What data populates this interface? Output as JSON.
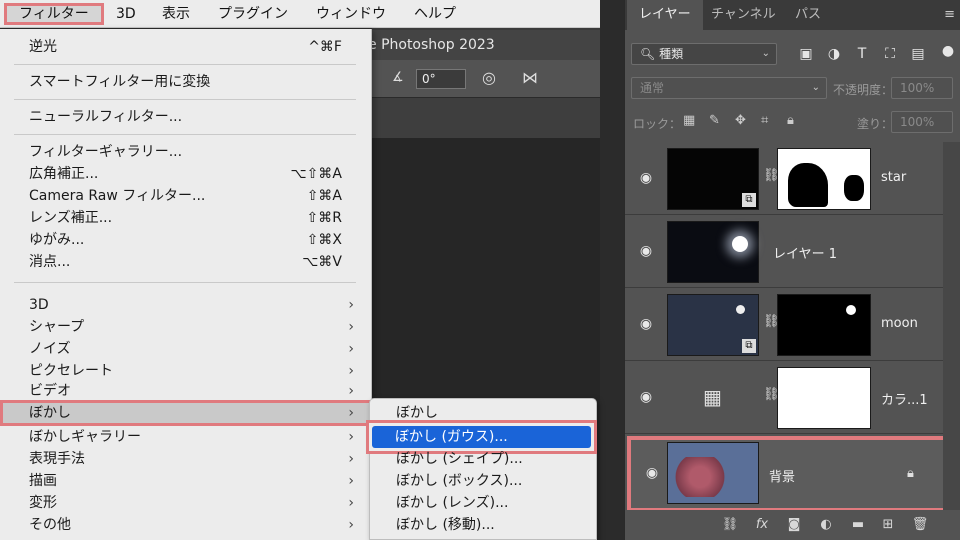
{
  "menubar": {
    "filter": "フィルター",
    "d3": "3D",
    "view": "表示",
    "plugins": "プラグイン",
    "window": "ウィンドウ",
    "help": "ヘルプ"
  },
  "ps": {
    "title": "e Photoshop 2023",
    "angle": "0°"
  },
  "menu": {
    "reapply": {
      "label": "逆光",
      "sc": "^⌘F"
    },
    "convert_smart": "スマートフィルター用に変換",
    "neural": "ニューラルフィルター...",
    "gallery": "フィルターギャラリー...",
    "wide_angle": {
      "label": "広角補正...",
      "sc": "⌥⇧⌘A"
    },
    "camera_raw": {
      "label": "Camera Raw フィルター...",
      "sc": "⇧⌘A"
    },
    "lens": {
      "label": "レンズ補正...",
      "sc": "⇧⌘R"
    },
    "liquify": {
      "label": "ゆがみ...",
      "sc": "⇧⌘X"
    },
    "vanishing": {
      "label": "消点...",
      "sc": "⌥⌘V"
    },
    "groups": [
      "3D",
      "シャープ",
      "ノイズ",
      "ピクセレート",
      "ビデオ",
      "ぼかし",
      "ぼかしギャラリー",
      "表現手法",
      "描画",
      "変形",
      "その他"
    ]
  },
  "submenu": [
    "ぼかし",
    "ぼかし (ガウス)...",
    "ぼかし (シェイプ)...",
    "ぼかし (ボックス)...",
    "ぼかし (レンズ)...",
    "ぼかし (移動)..."
  ],
  "panel": {
    "tabs": [
      "レイヤー",
      "チャンネル",
      "パス"
    ],
    "filter_kind": "種類",
    "blend": "通常",
    "opacity_label": "不透明度：",
    "opacity": "100%",
    "lock_label": "ロック：",
    "fill_label": "塗り：",
    "fill": "100%",
    "layers": [
      "star",
      "レイヤー 1",
      "moon",
      "カラ...1",
      "背景"
    ]
  },
  "colors": {
    "highlight": "#e07a7e",
    "selection": "#1a64d8"
  }
}
